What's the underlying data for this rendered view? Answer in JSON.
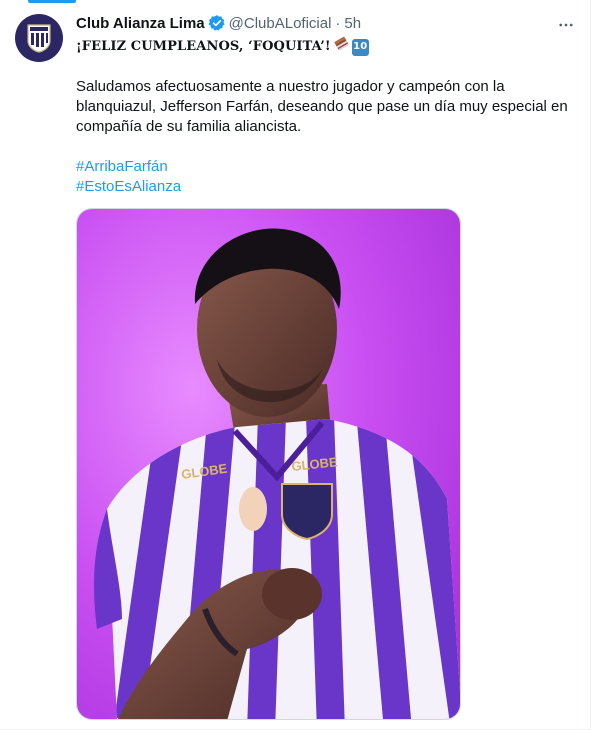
{
  "tweet": {
    "display_name": "Club Alianza Lima",
    "handle": "@ClubALoficial",
    "separator": "·",
    "time": "5h",
    "headline": "¡FELIZ CUMPLEANOS, ‘FOQUITA’!",
    "emoji_badge": "10",
    "paragraph": "Saludamos afectuosamente a nuestro jugador y campeón con la blanquiazul, Jefferson Farfán, deseando que pase un día muy especial en compañía de su familia aliancista.",
    "hashtags": [
      "#ArribaFarfán",
      "#EstoEsAlianza"
    ]
  },
  "photo": {
    "jersey_sponsor": "GLOBE"
  },
  "colors": {
    "accent": "#1d9bf0",
    "avatar_bg": "#2b2664",
    "photo_bg": "#c94ff2",
    "jersey_purple": "#6a35c9"
  },
  "icons": {
    "verified": "verified-badge-icon",
    "more": "more-horizontal-icon",
    "chocolate": "chocolate-bar-emoji",
    "ten": "keycap-ten-emoji"
  }
}
